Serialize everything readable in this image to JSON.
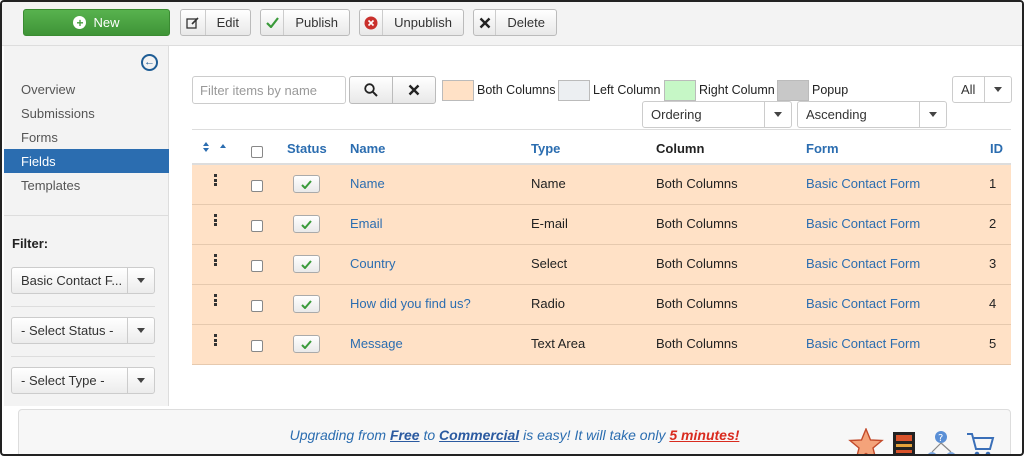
{
  "toolbar": {
    "new_label": "New",
    "edit_label": "Edit",
    "publish_label": "Publish",
    "unpublish_label": "Unpublish",
    "delete_label": "Delete"
  },
  "sidebar": {
    "items": [
      {
        "label": "Overview",
        "active": false
      },
      {
        "label": "Submissions",
        "active": false
      },
      {
        "label": "Forms",
        "active": false
      },
      {
        "label": "Fields",
        "active": true
      },
      {
        "label": "Templates",
        "active": false
      }
    ],
    "filter_label": "Filter:",
    "filters": [
      {
        "value": "Basic Contact F..."
      },
      {
        "value": "- Select Status -"
      },
      {
        "value": "- Select Type -"
      }
    ]
  },
  "filterbar": {
    "search_placeholder": "Filter items by name",
    "legend": [
      {
        "label": "Both Columns",
        "color": "#ffe1c6"
      },
      {
        "label": "Left Column",
        "color": "#eceff2"
      },
      {
        "label": "Right Column",
        "color": "#c6f7c6"
      },
      {
        "label": "Popup",
        "color": "#c8c8c8"
      }
    ],
    "limit_value": "All",
    "ordering_value": "Ordering",
    "direction_value": "Ascending"
  },
  "table": {
    "headers": {
      "status": "Status",
      "name": "Name",
      "type": "Type",
      "column": "Column",
      "form": "Form",
      "id": "ID"
    },
    "rows": [
      {
        "name": "Name",
        "type": "Name",
        "column": "Both Columns",
        "form": "Basic Contact Form",
        "id": "1",
        "published": true
      },
      {
        "name": "Email",
        "type": "E-mail",
        "column": "Both Columns",
        "form": "Basic Contact Form",
        "id": "2",
        "published": true
      },
      {
        "name": "Country",
        "type": "Select",
        "column": "Both Columns",
        "form": "Basic Contact Form",
        "id": "3",
        "published": true
      },
      {
        "name": "How did you find us?",
        "type": "Radio",
        "column": "Both Columns",
        "form": "Basic Contact Form",
        "id": "4",
        "published": true
      },
      {
        "name": "Message",
        "type": "Text Area",
        "column": "Both Columns",
        "form": "Basic Contact Form",
        "id": "5",
        "published": true
      }
    ]
  },
  "promo": {
    "part1": "Upgrading from ",
    "free": "Free",
    "part2": " to ",
    "commercial": "Commercial",
    "part3": " is easy! It will take only ",
    "minutes": "5 minutes!"
  },
  "colors": {
    "accent": "#2b6db0",
    "new_button": "#46a03e",
    "row_both_columns": "#ffe1c6"
  }
}
